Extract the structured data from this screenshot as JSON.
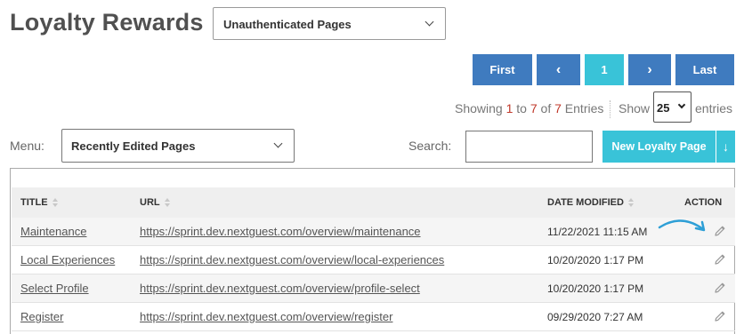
{
  "header": {
    "title": "Loyalty Rewards",
    "page_filter": "Unauthenticated Pages"
  },
  "pagination": {
    "first": "First",
    "prev": "‹",
    "current": "1",
    "next": "›",
    "last": "Last"
  },
  "summary": {
    "prefix": "Showing ",
    "from": "1",
    "to_word": " to ",
    "to": "7",
    "of_word": " of ",
    "total": "7",
    "suffix": " Entries"
  },
  "entries": {
    "show_label": "Show",
    "value": "25",
    "suffix": "entries"
  },
  "toolbar": {
    "menu_label": "Menu:",
    "menu_value": "Recently Edited Pages",
    "search_label": "Search:",
    "search_value": "",
    "new_button": "New Loyalty Page",
    "download_icon": "↓"
  },
  "table": {
    "columns": {
      "title": "TITLE",
      "url": "URL",
      "date": "DATE MODIFIED",
      "action": "ACTION"
    },
    "rows": [
      {
        "title": "Maintenance",
        "url": "https://sprint.dev.nextguest.com/overview/maintenance",
        "date": "11/22/2021 11:15 AM"
      },
      {
        "title": "Local Experiences",
        "url": "https://sprint.dev.nextguest.com/overview/local-experiences",
        "date": "10/20/2020 1:17 PM"
      },
      {
        "title": "Select Profile",
        "url": "https://sprint.dev.nextguest.com/overview/profile-select",
        "date": "10/20/2020 1:17 PM"
      },
      {
        "title": "Register",
        "url": "https://sprint.dev.nextguest.com/overview/register",
        "date": "09/29/2020 7:27 AM"
      }
    ]
  },
  "colors": {
    "primary": "#3f7bbf",
    "accent": "#39c3d8",
    "highlight": "#c0392b"
  },
  "icons": {
    "row_action": "pencil-icon",
    "annotation": "curved-arrow-icon"
  }
}
